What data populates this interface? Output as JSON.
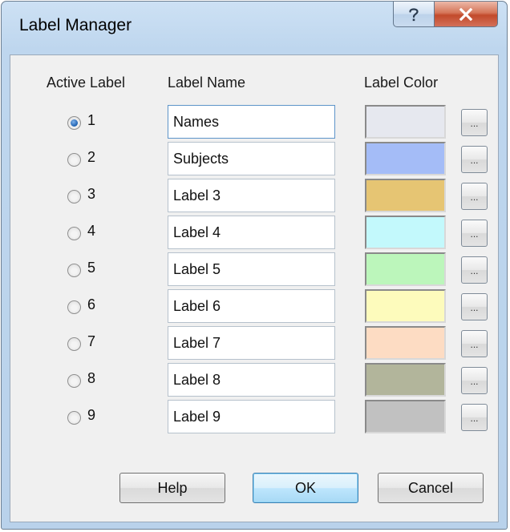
{
  "window": {
    "title": "Label Manager",
    "help_icon": "question-mark-icon",
    "close_icon": "close-x-icon"
  },
  "headers": {
    "active": "Active Label",
    "name": "Label Name",
    "color": "Label Color"
  },
  "active_label": 1,
  "labels": [
    {
      "number": "1",
      "name": "Names",
      "color": "#e6e8ef"
    },
    {
      "number": "2",
      "name": "Subjects",
      "color": "#a4bcf7"
    },
    {
      "number": "3",
      "name": "Label 3",
      "color": "#e6c573"
    },
    {
      "number": "4",
      "name": "Label 4",
      "color": "#c3f9fc"
    },
    {
      "number": "5",
      "name": "Label 5",
      "color": "#bcf6bb"
    },
    {
      "number": "6",
      "name": "Label 6",
      "color": "#fdfbbc"
    },
    {
      "number": "7",
      "name": "Label 7",
      "color": "#fddcc3"
    },
    {
      "number": "8",
      "name": "Label 8",
      "color": "#b2b59b"
    },
    {
      "number": "9",
      "name": "Label 9",
      "color": "#c1c1c1"
    }
  ],
  "ellipsis_label": "...",
  "buttons": {
    "help": "Help",
    "ok": "OK",
    "cancel": "Cancel"
  }
}
